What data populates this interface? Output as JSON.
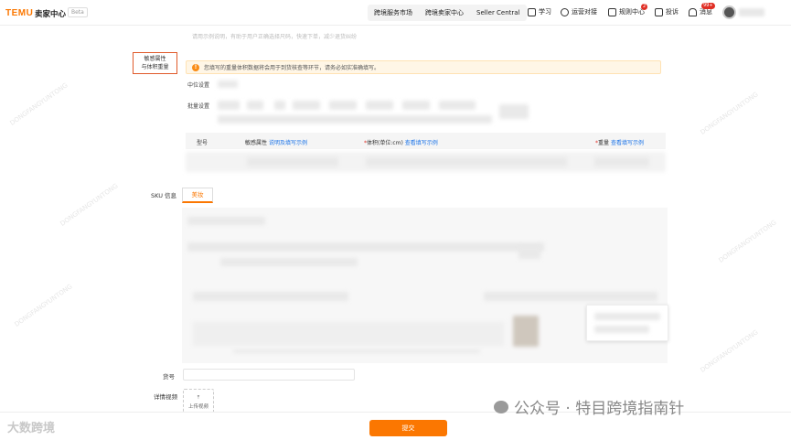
{
  "header": {
    "logo": "TEMU",
    "logo_sub": "卖家中心",
    "beta": "Beta",
    "nav_tabs": [
      "跨境服务市场",
      "跨境卖家中心",
      "Seller Central"
    ],
    "items": [
      {
        "label": "学习",
        "icon": "book-icon"
      },
      {
        "label": "运营对接",
        "icon": "chat-icon"
      },
      {
        "label": "规则中心",
        "icon": "rules-icon",
        "badge": "2"
      },
      {
        "label": "投诉",
        "icon": "edit-icon"
      },
      {
        "label": "消息",
        "icon": "bell-icon",
        "badge": "99+"
      }
    ]
  },
  "form": {
    "top_hint": "请用示例说明，有助于用户正确选择尺码，快速下单，减少退货纠纷",
    "highlight_label_line1": "敏感属性",
    "highlight_label_line2": "与体积重量",
    "warning_text": "您填写的重量体积数据将会用于到货核查等环节，请务必如实准确填写。",
    "middle_label": "中位设置",
    "batch_label": "批量设置",
    "table_headers": {
      "col1": "型号",
      "col2": "敏感属性",
      "col2_link": "说明及填写示例",
      "col3": "体积(单位:cm)",
      "col3_link": "查看填写示例",
      "col4": "重量",
      "col4_link": "查看填写示例",
      "required_mark": "*"
    },
    "sku_label": "SKU 信息",
    "sku_tab": "美妆",
    "code_label": "货号",
    "video_label": "详情视频",
    "upload_label": "上传视频"
  },
  "footer": {
    "submit": "提交"
  },
  "watermarks": {
    "left": "大数跨境",
    "right": "公众号 · 特目跨境指南针",
    "diagonal": "DONGFANGYUNTONG"
  },
  "colors": {
    "brand": "#fb7701",
    "link": "#1a73e8",
    "warning_bg": "#fff6e6",
    "highlight_border": "#e05a2b"
  }
}
